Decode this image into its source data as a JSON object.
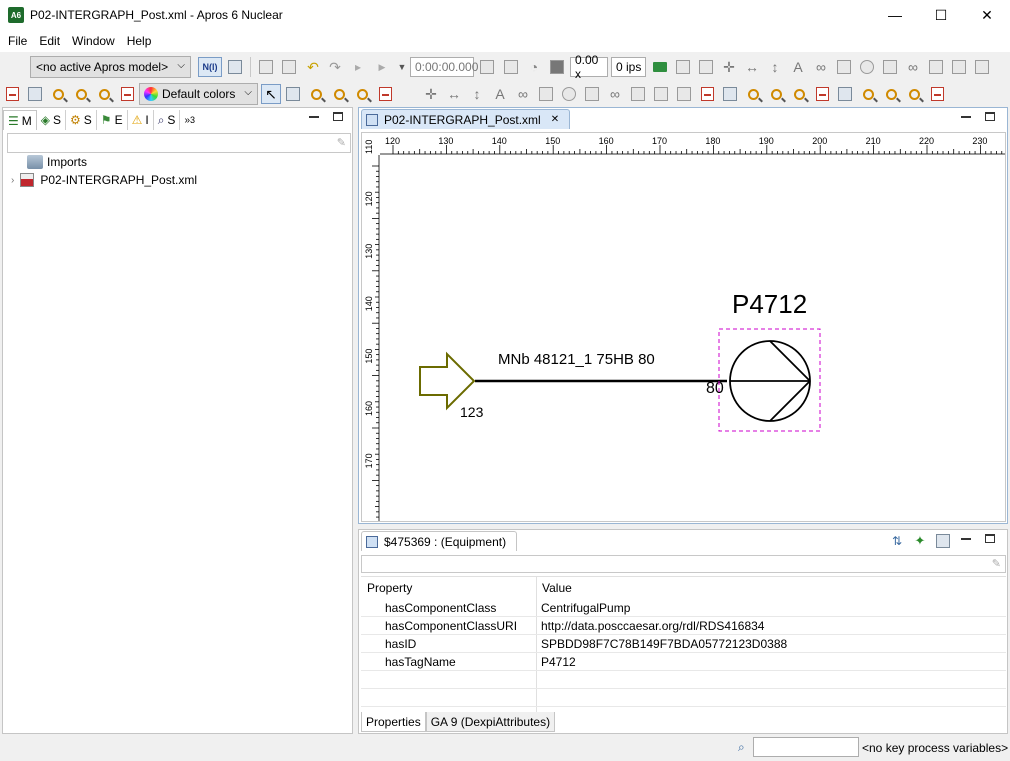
{
  "window": {
    "title": "P02-INTERGRAPH_Post.xml - Apros 6 Nuclear",
    "app_icon": "A6",
    "minimize_glyph": "—",
    "maximize_glyph": "☐",
    "close_glyph": "✕"
  },
  "menu": {
    "items": [
      "File",
      "Edit",
      "Window",
      "Help"
    ]
  },
  "toolbar": {
    "model_combo": "<no active Apros model>",
    "time_field": "0:00:00.000",
    "speed_field": "0.00 x",
    "ips_field": "0 ips",
    "colors_combo": "Default colors",
    "nl_button": "N(l)"
  },
  "left_panel": {
    "tabs": [
      "M",
      "S",
      "S",
      "E",
      "I",
      "S",
      "3"
    ],
    "tree": [
      {
        "label": "Imports",
        "icon": "imports-icon"
      },
      {
        "label": "P02-INTERGRAPH_Post.xml",
        "icon": "diagram-file-icon"
      }
    ]
  },
  "editor": {
    "tab_title": "P02-INTERGRAPH_Post.xml",
    "ruler_x": [
      "120",
      "130",
      "140",
      "150",
      "160",
      "170",
      "180",
      "190",
      "200",
      "210",
      "220",
      "230"
    ],
    "ruler_y": [
      "110",
      "120",
      "130",
      "140",
      "150",
      "160",
      "170"
    ],
    "diagram": {
      "pump_tag": "P4712",
      "line_label": "MNb 48121_1 75HB  80",
      "nozzle_label": "80",
      "arrow_label": "123",
      "selection_color": "#cc00cc",
      "arrow_color": "#6b6b00"
    }
  },
  "properties": {
    "tab_title": "$475369 : (Equipment)",
    "col_property": "Property",
    "col_value": "Value",
    "rows": [
      {
        "property": "hasComponentClass",
        "value": "CentrifugalPump"
      },
      {
        "property": "hasComponentClassURI",
        "value": "http://data.posccaesar.org/rdl/RDS416834"
      },
      {
        "property": "hasID",
        "value": "SPBDD98F7C78B149F7BDA05772123D0388"
      },
      {
        "property": "hasTagName",
        "value": "P4712"
      }
    ],
    "bottom_tabs": [
      "Properties",
      "GA 9 (DexpiAttributes)"
    ]
  },
  "statusbar": {
    "key_vars": "<no key process variables>"
  }
}
